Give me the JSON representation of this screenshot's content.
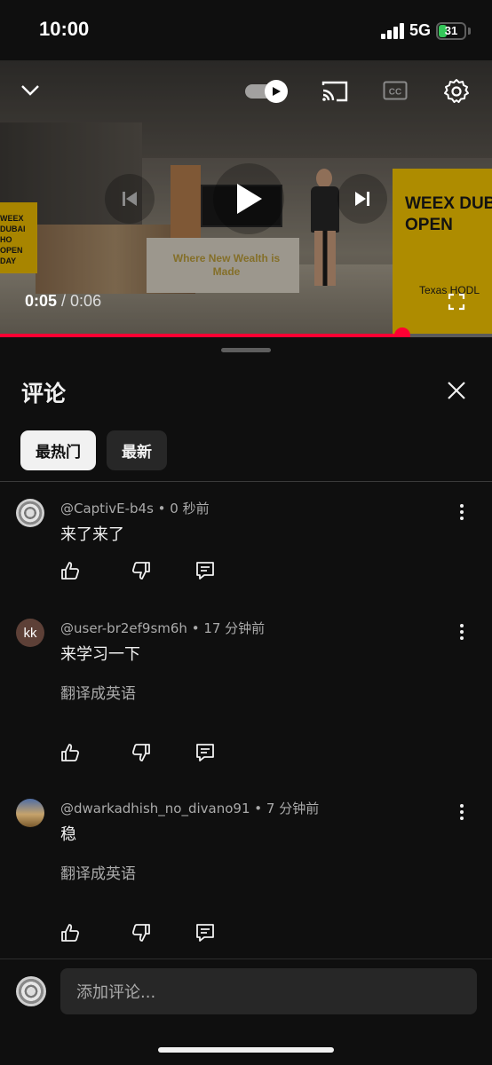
{
  "status_bar": {
    "time": "10:00",
    "network": "5G",
    "battery_level": "31",
    "battery_fraction": 0.31
  },
  "video": {
    "desk_sign": "Where New Wealth is Made",
    "banner_right": "WEEX DUB OPEN",
    "banner_right_sub": "Texas HODL",
    "banner_left": "WEEX DUBAI HO OPEN DAY",
    "current_time": "0:05",
    "separator": " / ",
    "duration": "0:06",
    "progress_fraction": 0.818,
    "autoplay_on": true,
    "icons": {
      "collapse": "chevron-down-icon",
      "autoplay": "autoplay-toggle",
      "cast": "cast-icon",
      "captions": "captions-icon",
      "settings": "gear-icon",
      "previous": "skip-previous-icon",
      "play": "play-icon",
      "next": "skip-next-icon",
      "fullscreen": "fullscreen-icon"
    }
  },
  "comments_panel": {
    "title": "评论",
    "chips": [
      "最热门",
      "最新"
    ],
    "active_chip": "最热门",
    "comments": [
      {
        "author": "@CaptivE-b4s",
        "time": "0 秒前",
        "text": "来了来了",
        "translate": "",
        "avatar": "mandala-avatar"
      },
      {
        "author": "@user-br2ef9sm6h",
        "time": "17 分钟前",
        "text": "来学习一下",
        "translate": "翻译成英语",
        "avatar": "kk",
        "avatar_color": "#5d4037"
      },
      {
        "author": "@dwarkadhish_no_divano91",
        "time": "7 分钟前",
        "text": "稳",
        "translate": "翻译成英语",
        "avatar": "photo-avatar"
      }
    ],
    "compose_placeholder": "添加评论..."
  },
  "colors": {
    "background": "#0f0f0f",
    "accent_red": "#ff0033",
    "chip_active": "#f1f1f1",
    "chip_inactive": "#272727",
    "secondary_text": "#aaaaaa"
  }
}
